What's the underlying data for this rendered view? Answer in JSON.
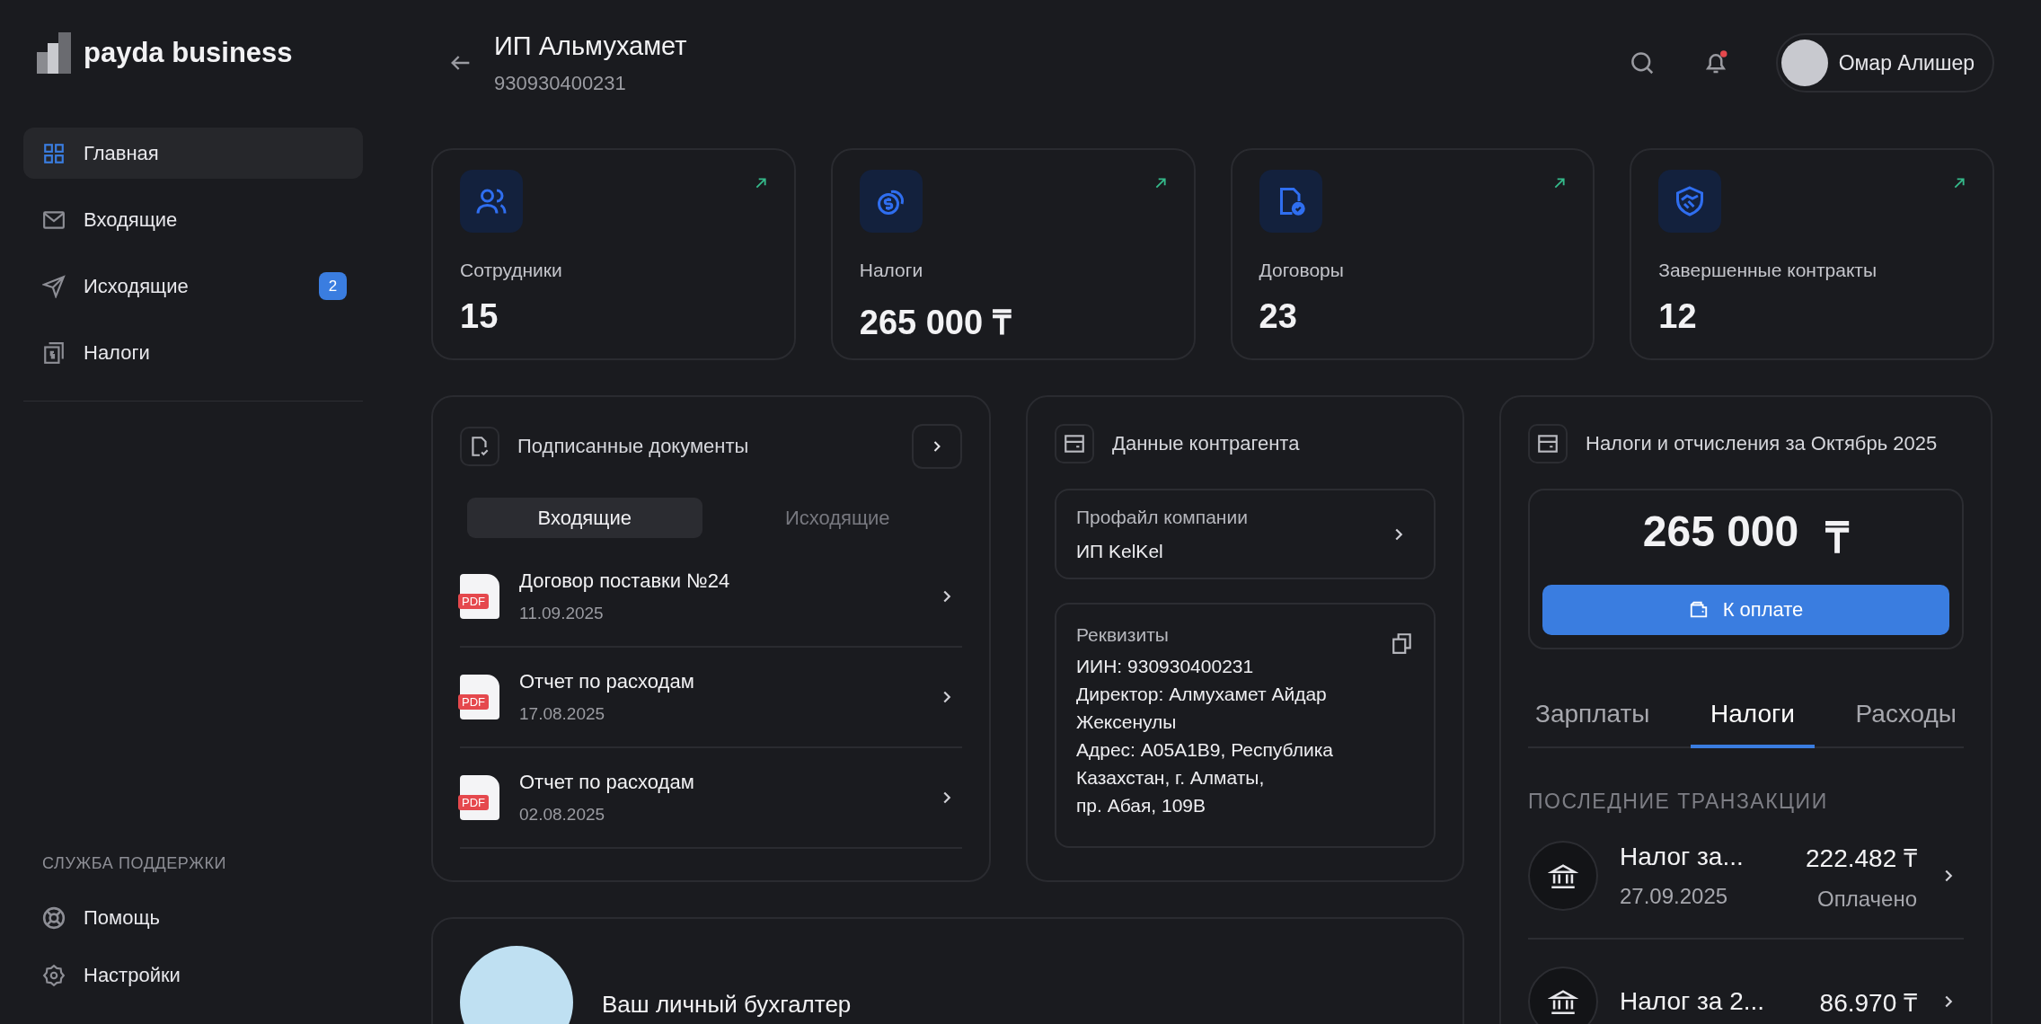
{
  "sidebar": {
    "logo": "payda business",
    "nav": [
      {
        "label": "Главная",
        "kind": "grid",
        "selected": true
      },
      {
        "label": "Входящие",
        "kind": "mail",
        "selected": false
      },
      {
        "label": "Исходящие",
        "kind": "send",
        "selected": false,
        "badge": "2"
      },
      {
        "label": "Налоги",
        "kind": "tax",
        "selected": false
      }
    ],
    "support_title": "СЛУЖБА ПОДДЕРЖКИ",
    "support": [
      {
        "label": "Помощь",
        "kind": "help"
      },
      {
        "label": "Настройки",
        "kind": "settings"
      }
    ]
  },
  "header": {
    "title": "ИП Альмухамет",
    "subtitle": "930930400231",
    "notification_dot": true,
    "user": "Омар Алишер"
  },
  "stats": [
    {
      "kind": "users",
      "label": "Сотрудники",
      "value": "15"
    },
    {
      "kind": "coins",
      "label": "Налоги",
      "value": "265 000 ₸"
    },
    {
      "kind": "contract",
      "label": "Договоры",
      "value": "23"
    },
    {
      "kind": "handshake",
      "label": "Завершенные контракты",
      "value": "12"
    }
  ],
  "documents": {
    "title": "Подписанные документы",
    "tabs": [
      {
        "label": "Входящие",
        "selected": true
      },
      {
        "label": "Исходящие",
        "selected": false
      }
    ],
    "items": [
      {
        "badge": "PDF",
        "title": "Договор поставки №24",
        "date": "11.09.2025"
      },
      {
        "badge": "PDF",
        "title": "Отчет по расходам",
        "date": "17.08.2025"
      },
      {
        "badge": "PDF",
        "title": "Отчет по расходам",
        "date": "02.08.2025"
      }
    ]
  },
  "counterparty": {
    "title": "Данные контрагента",
    "profile": {
      "label": "Профайл компании",
      "value": "ИП KelKel"
    },
    "requisites": {
      "title": "Реквизиты",
      "lines": [
        "ИИН: 930930400231",
        "Директор: Алмухамет Айдар Жексенулы",
        "Адрес: A05A1B9, Республика Казахстан, г. Алматы,",
        "пр. Абая, 109В"
      ]
    }
  },
  "taxes": {
    "title": "Налоги и отчисления за Октябрь 2025",
    "amount": "265 000",
    "currency": "₸",
    "pay_button": "К оплате",
    "tabs": [
      {
        "label": "Зарплаты",
        "selected": false
      },
      {
        "label": "Налоги",
        "selected": true
      },
      {
        "label": "Расходы",
        "selected": false
      }
    ],
    "section_title": "ПОСЛЕДНИЕ ТРАНЗАКЦИИ",
    "transactions": [
      {
        "title": "Налог за...",
        "date": "27.09.2025",
        "amount": "222.482 ₸",
        "status": "Оплачено"
      },
      {
        "title": "Налог за 2...",
        "amount": "86.970 ₸"
      }
    ]
  },
  "accountant": {
    "title": "Ваш личный бухгалтер"
  }
}
